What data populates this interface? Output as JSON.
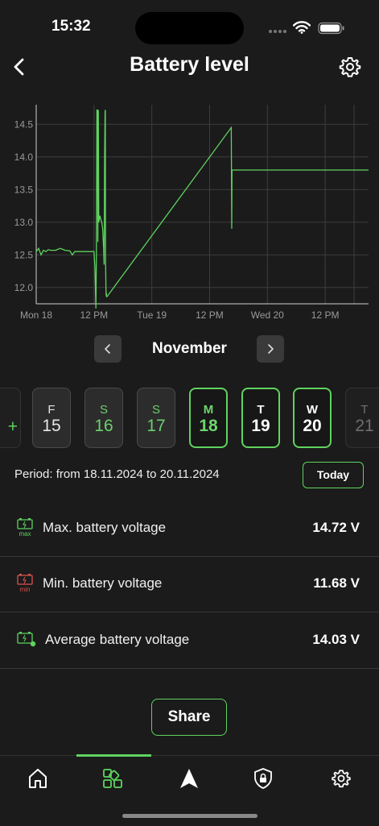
{
  "status_bar": {
    "time": "15:32"
  },
  "header": {
    "title": "Battery level"
  },
  "chart_data": {
    "type": "line",
    "title": "",
    "xlabel": "",
    "ylabel": "",
    "x_tick_labels": [
      "Mon 18",
      "12 PM",
      "Tue 19",
      "12 PM",
      "Wed 20",
      "12 PM"
    ],
    "x_unit": "hours since Mon 18 00:00",
    "xlim": [
      0,
      69
    ],
    "y_tick_labels": [
      "14.5",
      "14.0",
      "13.5",
      "13.0",
      "12.5",
      "12.0"
    ],
    "ylim": [
      11.75,
      14.8
    ],
    "grid": true,
    "series_color": "#5fd35f",
    "series": [
      {
        "x": [
          0,
          0.5,
          1,
          1.5,
          2,
          2.5,
          3,
          4,
          5,
          6,
          7,
          7.5,
          8,
          9,
          10,
          11,
          12,
          12.2,
          12.4,
          12.5,
          12.6,
          12.7,
          12.8,
          12.9,
          13.0,
          13.2,
          13.4,
          13.6,
          13.8,
          14.0,
          14.1,
          14.2,
          14.3,
          14.35,
          14.4,
          14.5,
          14.55,
          14.6,
          14.7,
          40.5,
          40.6,
          40.65,
          40.7,
          69
        ],
        "y": [
          12.55,
          12.6,
          12.5,
          12.57,
          12.55,
          12.58,
          12.57,
          12.57,
          12.6,
          12.57,
          12.56,
          12.5,
          12.55,
          12.55,
          12.55,
          12.55,
          12.55,
          12.3,
          11.68,
          12.5,
          14.72,
          14.72,
          12.7,
          14.72,
          13.0,
          13.1,
          13.05,
          13.0,
          12.9,
          12.6,
          12.35,
          14.0,
          14.7,
          14.72,
          12.4,
          11.88,
          11.92,
          11.86,
          11.86,
          14.45,
          12.9,
          13.8,
          13.8,
          13.8
        ]
      }
    ]
  },
  "month_nav": {
    "label": "November"
  },
  "days": [
    {
      "letter": "F",
      "num": "15"
    },
    {
      "letter": "S",
      "num": "16"
    },
    {
      "letter": "S",
      "num": "17"
    },
    {
      "letter": "M",
      "num": "18"
    },
    {
      "letter": "T",
      "num": "19"
    },
    {
      "letter": "W",
      "num": "20"
    },
    {
      "letter": "T",
      "num": "21"
    }
  ],
  "period": {
    "text": "Period: from 18.11.2024 to 20.11.2024",
    "today_label": "Today"
  },
  "stats": [
    {
      "icon": "battery-max-icon",
      "label": "Max. battery voltage",
      "value": "14.72 V",
      "icon_color": "#5fd35f"
    },
    {
      "icon": "battery-min-icon",
      "label": "Min. battery voltage",
      "value": "11.68 V",
      "icon_color": "#d9534f"
    },
    {
      "icon": "battery-average-icon",
      "label": "Average battery voltage",
      "value": "14.03 V",
      "icon_color": "#5fd35f"
    }
  ],
  "stat_icon_text": {
    "max": "max",
    "min": "min"
  },
  "share": {
    "label": "Share"
  },
  "tabs": [
    "home-icon",
    "dashboard-icon",
    "navigation-icon",
    "security-icon",
    "settings-icon"
  ],
  "colors": {
    "accent": "#5fd35f",
    "background": "#1b1b1b",
    "min_red": "#d9534f"
  }
}
